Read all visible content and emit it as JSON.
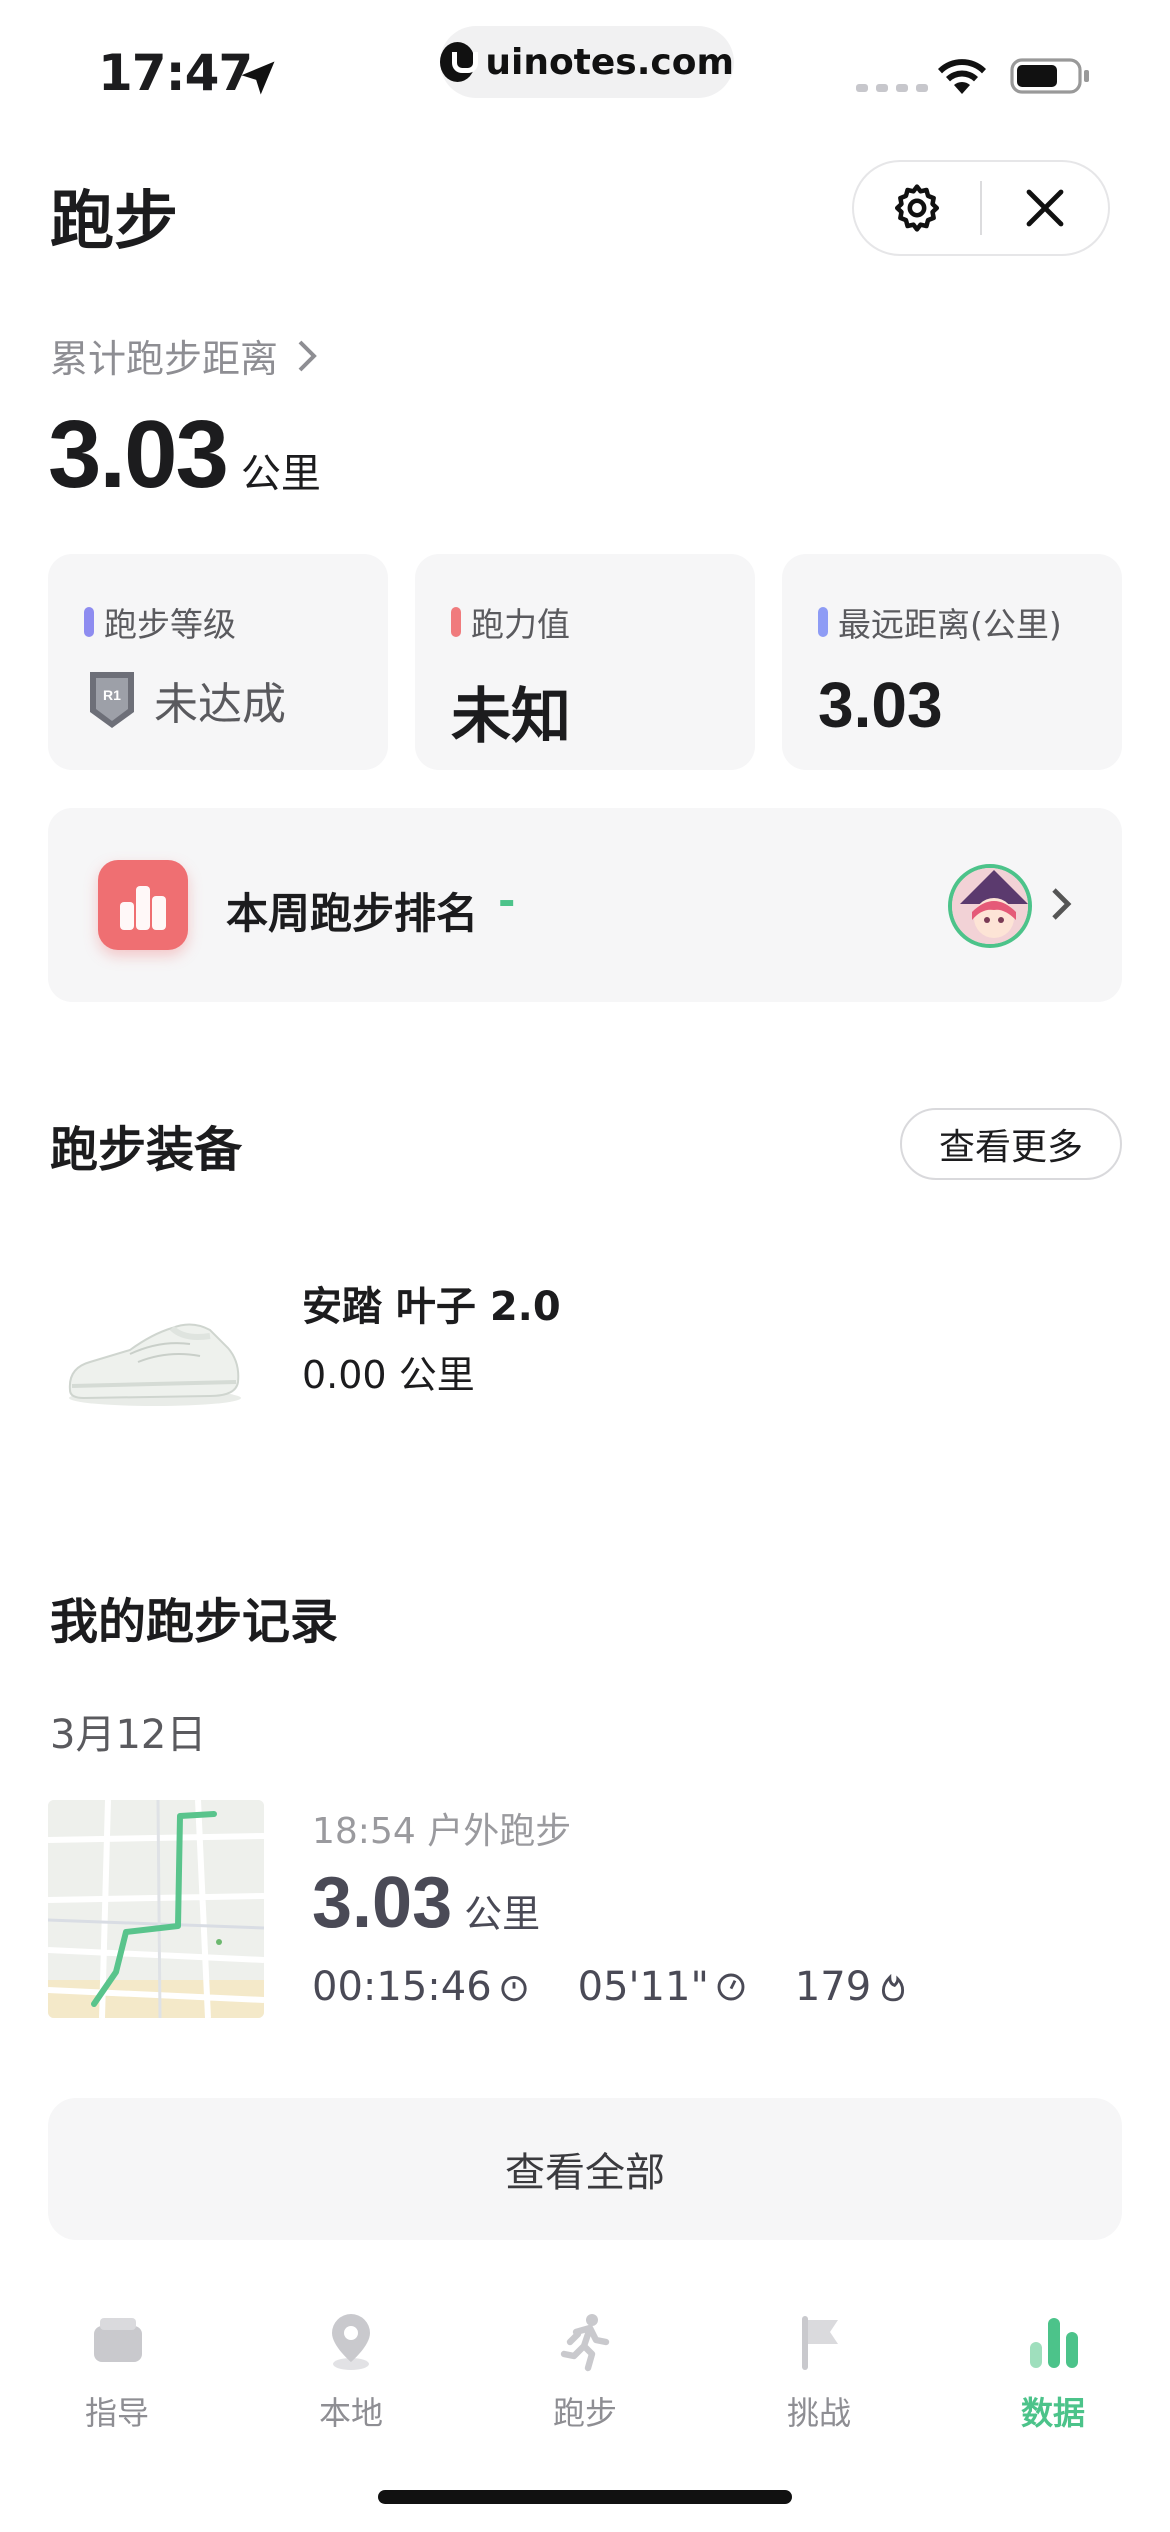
{
  "status_bar": {
    "time": "17:47",
    "url": "uinotes.com",
    "icons": [
      "location-arrow-icon",
      "signal-icon",
      "wifi-icon",
      "battery-icon"
    ]
  },
  "header": {
    "title": "跑步",
    "settings_icon": "gear-icon",
    "close_icon": "close-icon"
  },
  "total": {
    "label": "累计跑步距离",
    "value": "3.03",
    "unit": "公里"
  },
  "stats": [
    {
      "label": "跑步等级",
      "value": "未达成",
      "bar_color": "#8e8cf0",
      "icon": "badge-icon"
    },
    {
      "label": "跑力值",
      "value": "未知",
      "bar_color": "#f07b7d"
    },
    {
      "label": "最远距离(公里)",
      "value": "3.03",
      "bar_color": "#8e9cf5"
    }
  ],
  "ranking": {
    "title": "本周跑步排名",
    "value": "-",
    "icon": "ranking-icon",
    "avatar": "avatar"
  },
  "gear": {
    "title": "跑步装备",
    "more_label": "查看更多",
    "shoe_name": "安踏 叶子 2.0",
    "shoe_distance": "0.00 公里"
  },
  "records": {
    "title": "我的跑步记录",
    "date": "3月12日",
    "time_type": "18:54 户外跑步",
    "distance": "3.03",
    "unit": "公里",
    "duration": "00:15:46",
    "pace": "05'11\"",
    "calories": "179",
    "view_all_label": "查看全部"
  },
  "tabs": [
    {
      "label": "指导",
      "icon": "guide-icon",
      "active": false
    },
    {
      "label": "本地",
      "icon": "location-pin-icon",
      "active": false
    },
    {
      "label": "跑步",
      "icon": "runner-icon",
      "active": false
    },
    {
      "label": "挑战",
      "icon": "flag-icon",
      "active": false
    },
    {
      "label": "数据",
      "icon": "bar-chart-icon",
      "active": true
    }
  ],
  "colors": {
    "accent_green": "#4cc38a",
    "ranking_red": "#ef6f72",
    "card_bg": "#f6f6f7"
  }
}
